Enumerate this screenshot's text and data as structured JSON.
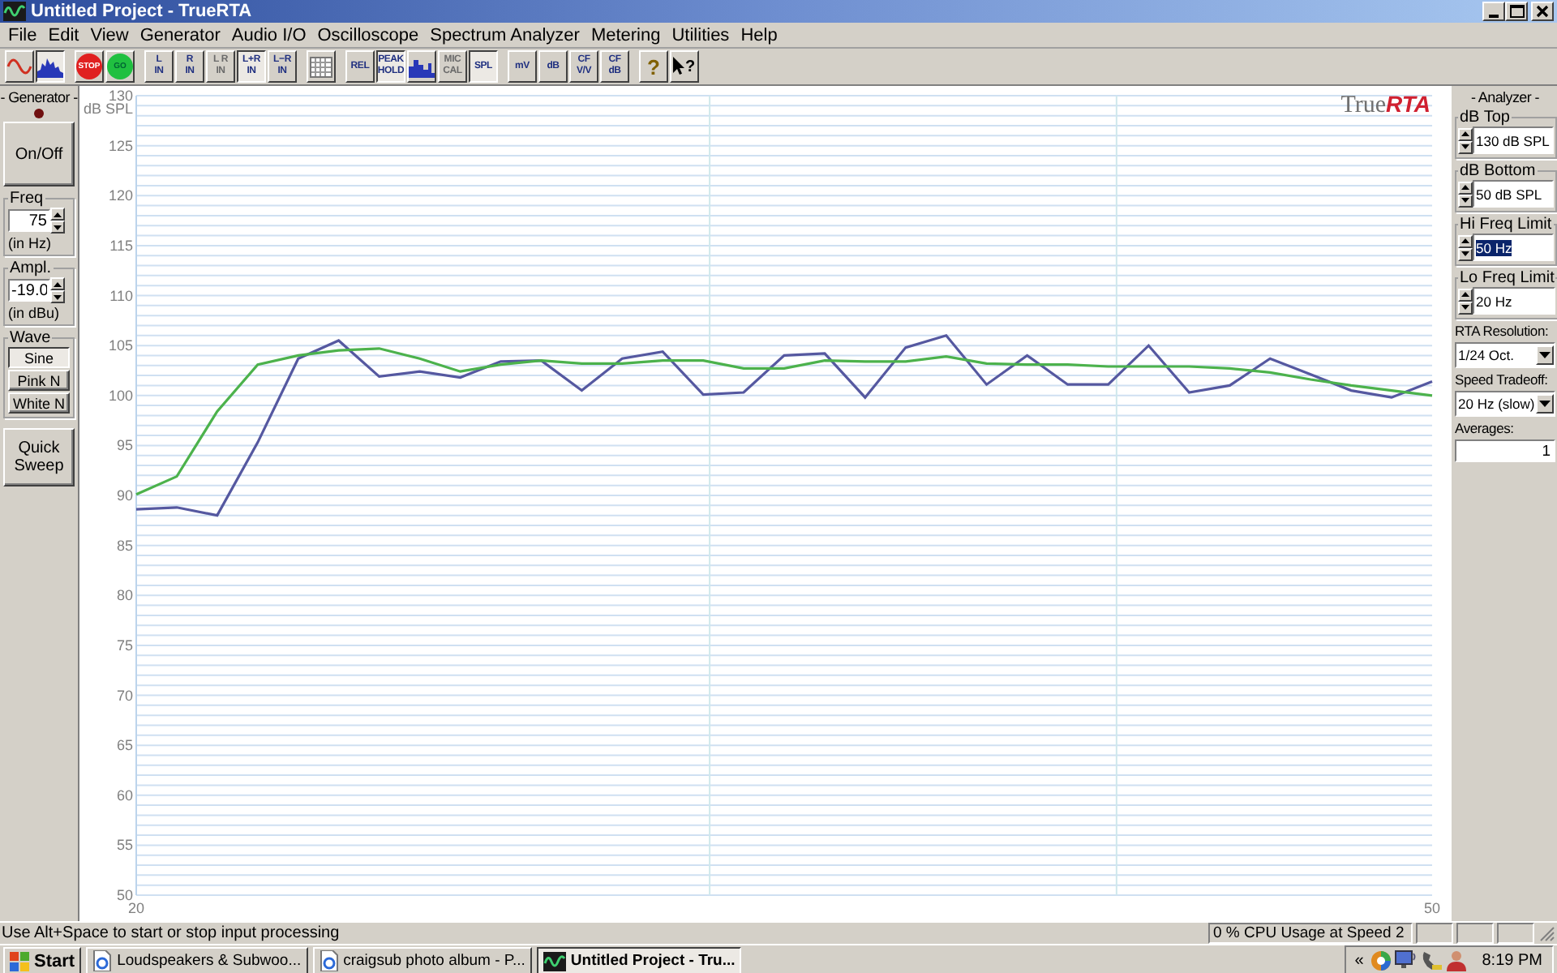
{
  "window": {
    "title": "Untitled Project - TrueRTA"
  },
  "menu": [
    "File",
    "Edit",
    "View",
    "Generator",
    "Audio I/O",
    "Oscilloscope",
    "Spectrum Analyzer",
    "Metering",
    "Utilities",
    "Help"
  ],
  "toolbar": {
    "groups": [
      [
        {
          "kind": "sine",
          "pressed": false,
          "disabled": false
        },
        {
          "kind": "spectrum",
          "pressed": true,
          "disabled": false
        }
      ],
      [
        {
          "kind": "stop",
          "label": "STOP",
          "pressed": false,
          "disabled": false
        },
        {
          "kind": "go",
          "label": "GO",
          "pressed": false,
          "disabled": false
        }
      ],
      [
        {
          "kind": "text",
          "lines": [
            "L",
            "IN"
          ],
          "pressed": false,
          "disabled": false
        },
        {
          "kind": "text",
          "lines": [
            "R",
            "IN"
          ],
          "pressed": false,
          "disabled": false
        },
        {
          "kind": "text",
          "lines": [
            "L R",
            "IN"
          ],
          "pressed": false,
          "disabled": true
        },
        {
          "kind": "text",
          "lines": [
            "L+R",
            "IN"
          ],
          "pressed": true,
          "disabled": false
        },
        {
          "kind": "text",
          "lines": [
            "L−R",
            "IN"
          ],
          "pressed": false,
          "disabled": false
        }
      ],
      [
        {
          "kind": "grid",
          "pressed": false,
          "disabled": false
        }
      ],
      [
        {
          "kind": "text",
          "lines": [
            "REL"
          ],
          "pressed": false,
          "disabled": false
        },
        {
          "kind": "text",
          "lines": [
            "PEAK",
            "HOLD"
          ],
          "pressed": true,
          "disabled": false
        },
        {
          "kind": "bars",
          "pressed": false,
          "disabled": false
        },
        {
          "kind": "text",
          "lines": [
            "MIC",
            "CAL"
          ],
          "pressed": false,
          "disabled": true
        },
        {
          "kind": "text",
          "lines": [
            "SPL"
          ],
          "pressed": true,
          "disabled": false
        }
      ],
      [
        {
          "kind": "text",
          "lines": [
            "mV"
          ],
          "pressed": false,
          "disabled": false
        },
        {
          "kind": "text",
          "lines": [
            "dB"
          ],
          "pressed": false,
          "disabled": false
        },
        {
          "kind": "text",
          "lines": [
            "CF",
            "V/V"
          ],
          "pressed": false,
          "disabled": false
        },
        {
          "kind": "text",
          "lines": [
            "CF",
            "dB"
          ],
          "pressed": false,
          "disabled": false
        }
      ],
      [
        {
          "kind": "help",
          "label": "?",
          "pressed": false,
          "disabled": false
        },
        {
          "kind": "pointer-help",
          "label": "?",
          "pressed": false,
          "disabled": false
        }
      ]
    ]
  },
  "generator": {
    "title": "- Generator -",
    "led_on": false,
    "power_button": "On/Off",
    "freq": {
      "label": "Freq",
      "value": "75",
      "unit": "(in Hz)"
    },
    "ampl": {
      "label": "Ampl.",
      "value": "-19.0",
      "unit": "(in dBu)"
    },
    "wave": {
      "label": "Wave",
      "options": [
        {
          "label": "Sine",
          "selected": true
        },
        {
          "label": "Pink N",
          "selected": false
        },
        {
          "label": "White N",
          "selected": false
        }
      ]
    },
    "sweep_button": "Quick Sweep"
  },
  "chart": {
    "logo": {
      "plain": "True",
      "accent": "RTA"
    },
    "x_axis_labels": [
      "20",
      "50"
    ],
    "chart_data": {
      "type": "line",
      "ylabel": "dB SPL",
      "grid": true,
      "ylim": [
        50,
        130
      ],
      "yticks": [
        50,
        55,
        60,
        65,
        70,
        75,
        80,
        85,
        90,
        95,
        100,
        105,
        110,
        115,
        120,
        125,
        130
      ],
      "series": [
        {
          "color": "#5558a0",
          "values": [
            88.6,
            88.8,
            88.0,
            95.3,
            103.7,
            105.5,
            101.9,
            102.4,
            101.8,
            103.4,
            103.5,
            100.5,
            103.7,
            104.4,
            100.1,
            100.3,
            104.0,
            104.2,
            99.8,
            104.8,
            106.0,
            101.1,
            104.0,
            101.1,
            101.1,
            105.0,
            100.3,
            101.0,
            103.7,
            102.1,
            100.5,
            99.8,
            101.4
          ]
        },
        {
          "color": "#4cb24c",
          "values": [
            90.1,
            91.9,
            98.4,
            103.1,
            104.0,
            104.5,
            104.7,
            103.7,
            102.4,
            103.1,
            103.5,
            103.2,
            103.2,
            103.5,
            103.5,
            102.7,
            102.7,
            103.5,
            103.4,
            103.4,
            103.9,
            103.2,
            103.1,
            103.1,
            102.9,
            102.9,
            102.9,
            102.7,
            102.3,
            101.6,
            101.0,
            100.5,
            100.0
          ]
        }
      ]
    }
  },
  "analyzer": {
    "title": "- Analyzer -",
    "spinners": [
      {
        "label": "dB Top",
        "value": "130 dB SPL",
        "selected": false
      },
      {
        "label": "dB Bottom",
        "value": "50 dB SPL",
        "selected": false
      },
      {
        "label": "Hi Freq Limit",
        "value": "50 Hz",
        "selected": true
      },
      {
        "label": "Lo Freq Limit",
        "value": "20 Hz",
        "selected": false
      }
    ],
    "dropdowns": [
      {
        "label": "RTA Resolution:",
        "value": "1/24 Oct."
      },
      {
        "label": "Speed Tradeoff:",
        "value": "20 Hz (slow)"
      }
    ],
    "averages": {
      "label": "Averages:",
      "value": "1"
    }
  },
  "status_bar": {
    "message": "Use Alt+Space to start or stop input processing",
    "cpu": "0 % CPU Usage at Speed 2"
  },
  "taskbar": {
    "start": "Start",
    "tasks": [
      {
        "label": "Loudspeakers & Subwoo...",
        "selected": false
      },
      {
        "label": "craigsub photo album - P...",
        "selected": false
      },
      {
        "label": "Untitled Project - Tru...",
        "selected": true
      }
    ],
    "tray_expand": "«",
    "clock": "8:19 PM"
  }
}
